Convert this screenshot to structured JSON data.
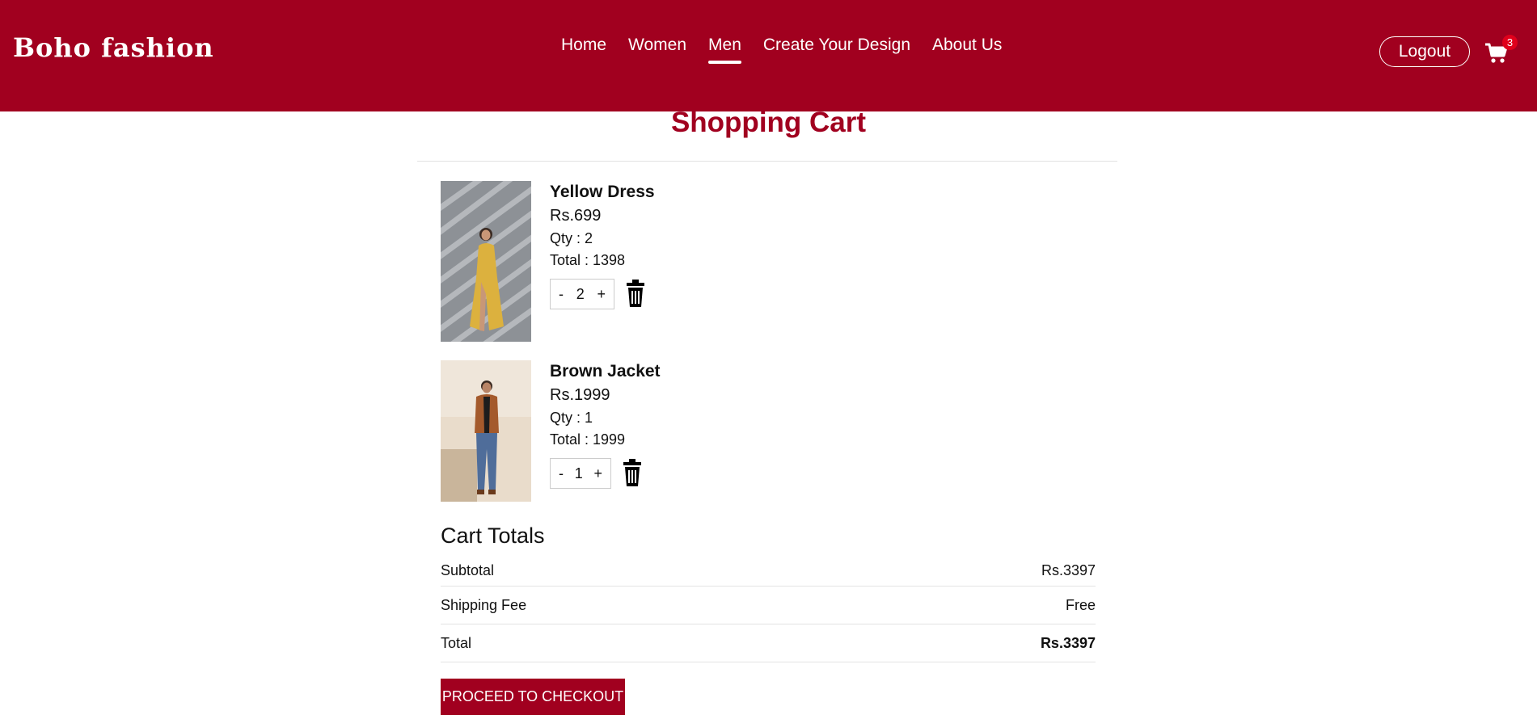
{
  "brand": "Boho fashion",
  "nav": {
    "items": [
      "Home",
      "Women",
      "Men",
      "Create Your Design",
      "About Us"
    ],
    "active": "Men"
  },
  "header": {
    "logout_label": "Logout",
    "cart_count": "3"
  },
  "colors": {
    "accent": "#a1001f",
    "badge": "#e0001b"
  },
  "page_title": "Shopping Cart",
  "cart_items": [
    {
      "name": "Yellow Dress",
      "price": "Rs.699",
      "qty_text": "Qty : 2",
      "total_text": "Total : 1398",
      "qty": "2",
      "image": "model-in-yellow-dress"
    },
    {
      "name": "Brown Jacket",
      "price": "Rs.1999",
      "qty_text": "Qty : 1",
      "total_text": "Total : 1999",
      "qty": "1",
      "image": "model-in-brown-jacket"
    }
  ],
  "stepper": {
    "minus": "-",
    "plus": "+"
  },
  "totals": {
    "title": "Cart Totals",
    "subtotal_label": "Subtotal",
    "subtotal_value": "Rs.3397",
    "shipping_label": "Shipping Fee",
    "shipping_value": "Free",
    "total_label": "Total",
    "total_value": "Rs.3397"
  },
  "checkout_label": "PROCEED TO CHECKOUT",
  "icons": {
    "cart": "shopping-cart-icon",
    "trash": "trash-icon"
  }
}
